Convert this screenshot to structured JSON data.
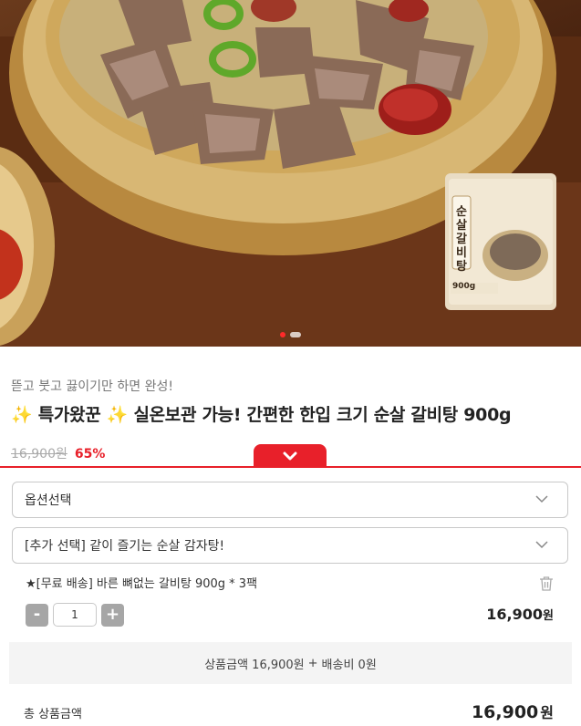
{
  "hero": {
    "package_name": "순살갈비탕",
    "package_weight": "900g",
    "slides_total": 2,
    "slide_active": 1
  },
  "product": {
    "subtitle": "뜯고 붓고 끓이기만 하면 완성!",
    "title_sparkle": "✨",
    "title_badge": "특가왔꾼",
    "title_main": "실온보관 가능! 간편한 한입 크기 순살 갈비탕 900g",
    "original_price": "16,900원",
    "discount": "65%"
  },
  "options": {
    "select_label": "옵션선택",
    "addon_label": "[추가 선택] 같이 즐기는 순살 감자탕!"
  },
  "cart_item": {
    "name": "★[무료 배송] 바른 뼈없는 갈비탕 900g * 3팩",
    "minus": "-",
    "quantity": "1",
    "plus": "+",
    "price": "16,900",
    "currency": "원"
  },
  "summary": {
    "product_amount": "상품금액 16,900원",
    "plus_sign": "+",
    "shipping": "배송비 0원"
  },
  "total": {
    "label": "총 상품금액",
    "amount": "16,900",
    "currency": "원"
  },
  "colors": {
    "accent": "#e8202a",
    "border": "#c8c8c8",
    "summary_bg": "#f4f4f4"
  },
  "icons": [
    "chevron-down-icon",
    "trash-icon",
    "sparkle-icon"
  ]
}
